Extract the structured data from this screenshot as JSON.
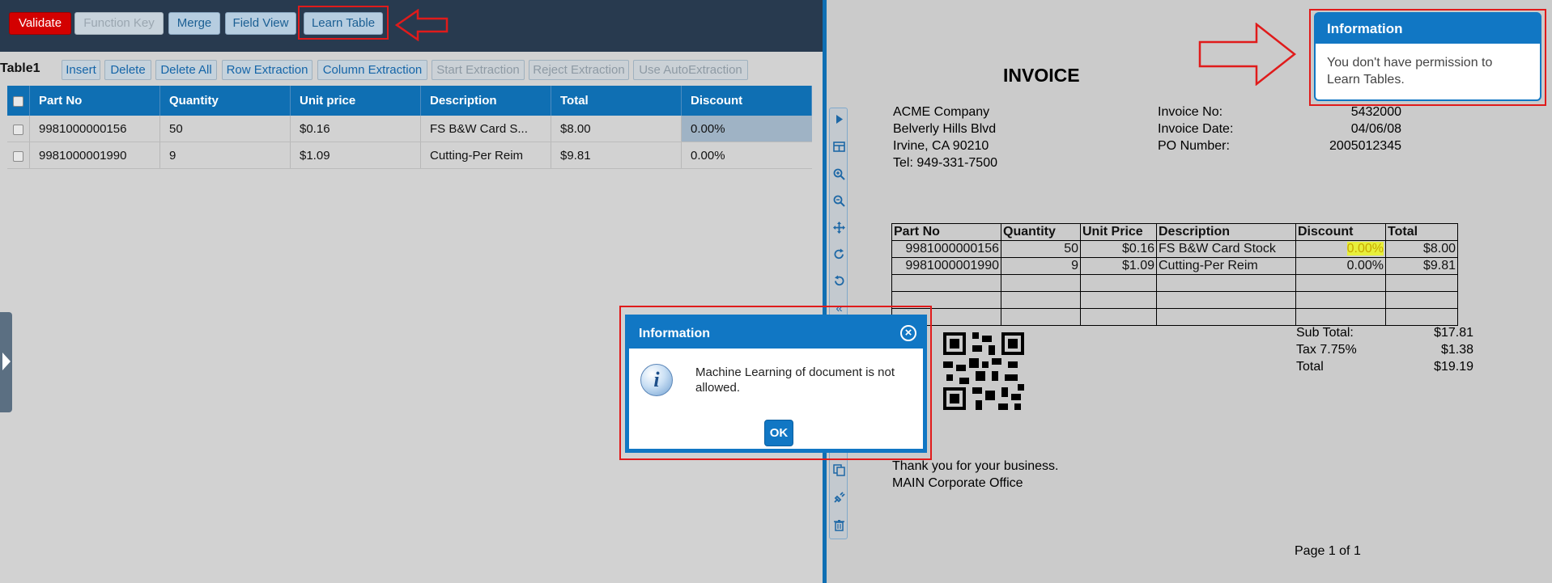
{
  "toolbar": {
    "validate": "Validate",
    "function_key": "Function Key",
    "merge": "Merge",
    "field_view": "Field View",
    "learn_table": "Learn Table"
  },
  "table": {
    "title": "Table1",
    "actions": {
      "insert": "Insert",
      "delete": "Delete",
      "delete_all": "Delete All",
      "row_extraction": "Row Extraction",
      "column_extraction": "Column Extraction",
      "start_extraction": "Start Extraction",
      "reject_extraction": "Reject Extraction",
      "use_autoextraction": "Use AutoExtraction"
    },
    "columns": [
      "Part No",
      "Quantity",
      "Unit price",
      "Description",
      "Total",
      "Discount"
    ],
    "rows": [
      [
        "9981000000156",
        "50",
        "$0.16",
        "FS B&W Card S...",
        "$8.00",
        "0.00%"
      ],
      [
        "9981000001990",
        "9",
        "$1.09",
        "Cutting-Per Reim",
        "$9.81",
        "0.00%"
      ]
    ]
  },
  "invoice": {
    "title": "INVOICE",
    "company": [
      "ACME Company",
      "Belverly Hills Blvd",
      "Irvine, CA 90210",
      "Tel: 949-331-7500"
    ],
    "meta_labels": [
      "Invoice No:",
      "Invoice Date:",
      "PO Number:"
    ],
    "meta_values": [
      "5432000",
      "04/06/08",
      "2005012345"
    ],
    "columns": [
      "Part No",
      "Quantity",
      "Unit Price",
      "Description",
      "Discount",
      "Total"
    ],
    "rows": [
      [
        "9981000000156",
        "50",
        "$0.16",
        "FS B&W Card Stock",
        "0.00%",
        "$8.00"
      ],
      [
        "9981000001990",
        "9",
        "$1.09",
        "Cutting-Per Reim",
        "0.00%",
        "$9.81"
      ]
    ],
    "totals_labels": [
      "Sub Total:",
      "Tax 7.75%",
      "Total"
    ],
    "totals_values": [
      "$17.81",
      "$1.38",
      "$19.19"
    ],
    "thanks": "Thank you for your business.",
    "office": "MAIN Corporate Office",
    "page": "Page 1 of 1"
  },
  "info_top": {
    "title": "Information",
    "message": "You don't have permission to Learn Tables."
  },
  "modal": {
    "title": "Information",
    "message": "Machine Learning of document is not allowed.",
    "ok": "OK"
  },
  "colors": {
    "toolbar_bg": "#283a4f",
    "accent": "#1177c4",
    "validate": "#d30000",
    "annotation": "#e01b1b"
  }
}
